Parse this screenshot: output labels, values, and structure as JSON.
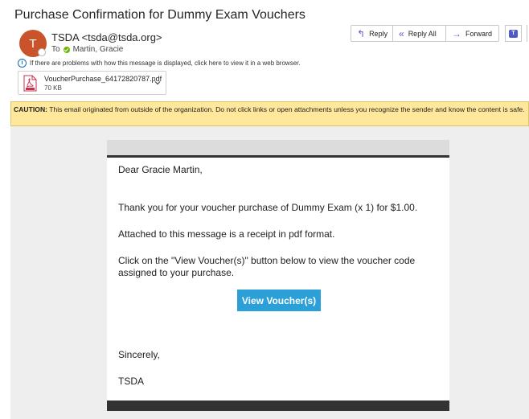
{
  "message": {
    "subject": "Purchase Confirmation for Dummy Exam Vouchers",
    "avatar_initial": "T",
    "sender_name": "TSDA",
    "sender_email": "<tsda@tsda.org>",
    "to_label": "To",
    "recipient": "Martin, Gracie",
    "info_text": "If there are problems with how this message is displayed, click here to view it in a web browser."
  },
  "attachment": {
    "filename": "VoucherPurchase_64172820787.pdf",
    "size": "70 KB",
    "icon": "pdf-icon"
  },
  "actions": {
    "reply": "Reply",
    "reply_all": "Reply All",
    "forward": "Forward"
  },
  "caution": {
    "label": "CAUTION:",
    "text": " This email originated from outside of the organization. Do not click links or open attachments unless you recognize the sender and know the content is safe."
  },
  "email_body": {
    "greeting": "Dear Gracie Martin,",
    "thanks": "Thank you for your voucher purchase of Dummy Exam (x 1) for $1.00.",
    "attached": "Attached to this message is a receipt in pdf format.",
    "click": "Click on the \"View Voucher(s)\" button below to view the voucher code assigned to your purchase.",
    "button": "View Voucher(s)",
    "closing": "Sincerely,",
    "signature": "TSDA"
  },
  "colors": {
    "avatar": "#c9542b",
    "caution_bg": "#ffe79b",
    "button_bg": "#2a9fd8",
    "accent": "#5b5fc7"
  }
}
